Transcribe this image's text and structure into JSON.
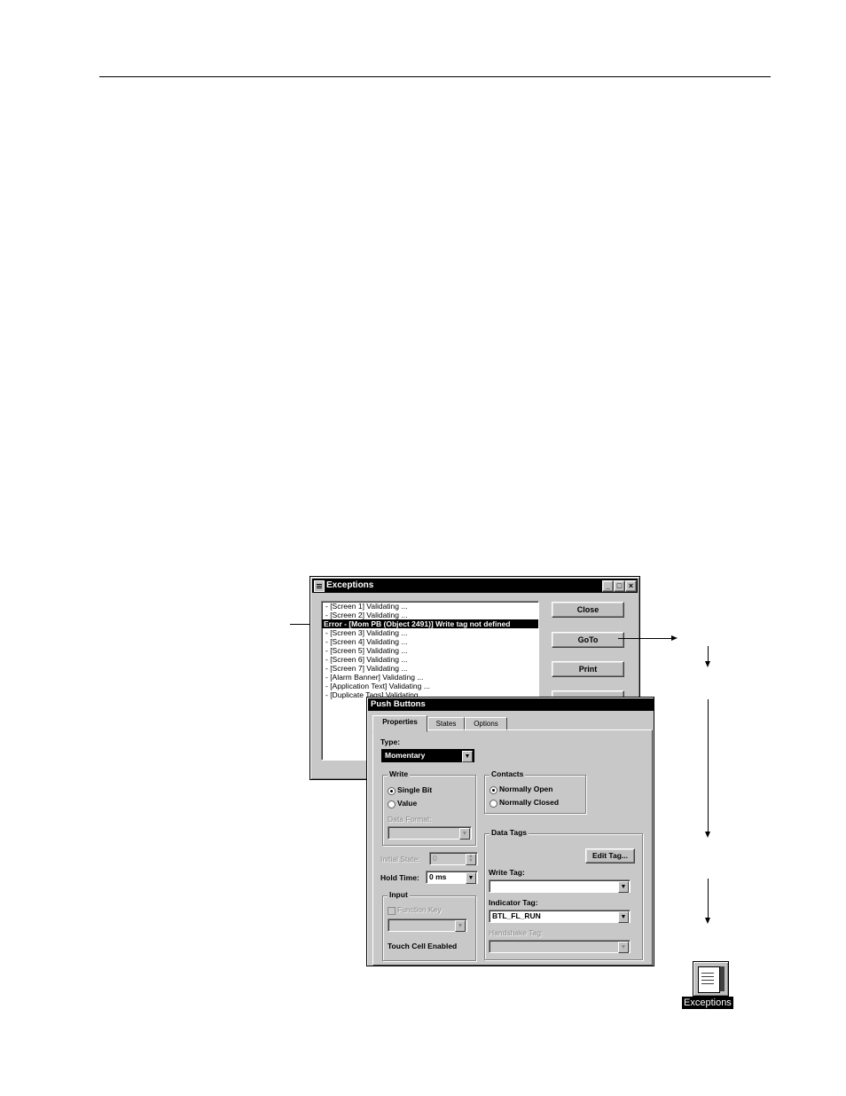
{
  "exceptions_window": {
    "title": "Exceptions",
    "controls": {
      "minimize": "_",
      "maximize": "□",
      "close": "×"
    },
    "list_items": [
      {
        "text": "- [Screen 1] Validating ...",
        "selected": false
      },
      {
        "text": "- [Screen 2] Validating ...",
        "selected": false
      },
      {
        "text": "Error - [Mom PB (Object 2491)] Write tag not defined",
        "selected": true
      },
      {
        "text": "- [Screen 3] Validating ...",
        "selected": false
      },
      {
        "text": "- [Screen 4] Validating ...",
        "selected": false
      },
      {
        "text": "- [Screen 5] Validating ...",
        "selected": false
      },
      {
        "text": "- [Screen 6] Validating ...",
        "selected": false
      },
      {
        "text": "- [Screen 7] Validating ...",
        "selected": false
      },
      {
        "text": "- [Alarm Banner] Validating ...",
        "selected": false
      },
      {
        "text": "- [Application Text] Validating ...",
        "selected": false
      },
      {
        "text": "- [Duplicate Tags] Validating ...",
        "selected": false
      }
    ],
    "buttons": {
      "close": "Close",
      "goto": "GoTo",
      "print": "Print"
    }
  },
  "push_buttons_dialog": {
    "title": "Push Buttons",
    "tabs": [
      {
        "label": "Properties",
        "active": true
      },
      {
        "label": "States",
        "active": false
      },
      {
        "label": "Options",
        "active": false
      }
    ],
    "type_label": "Type:",
    "type_value": "Momentary",
    "write_group": {
      "title": "Write",
      "single_bit": "Single Bit",
      "value": "Value",
      "selected": "Single Bit",
      "data_format_label": "Data Format:",
      "data_format_value": ""
    },
    "contacts_group": {
      "title": "Contacts",
      "normally_open": "Normally Open",
      "normally_closed": "Normally Closed",
      "selected": "Normally Open"
    },
    "initial_state_label": "Initial State:",
    "initial_state_value": "0",
    "hold_time_label": "Hold Time:",
    "hold_time_value": "0 ms",
    "input_group": {
      "title": "Input",
      "function_key_label": "Function Key",
      "function_key_value": "",
      "touch_cell_label": "Touch Cell Enabled"
    },
    "data_tags_group": {
      "title": "Data Tags",
      "edit_tag_button": "Edit Tag...",
      "write_tag_label": "Write Tag:",
      "write_tag_value": "",
      "indicator_tag_label": "Indicator Tag:",
      "indicator_tag_value": "BTL_FL_RUN",
      "handshake_tag_label": "Handshake Tag:",
      "handshake_tag_value": ""
    }
  },
  "desktop_icon": {
    "label": "Exceptions"
  }
}
